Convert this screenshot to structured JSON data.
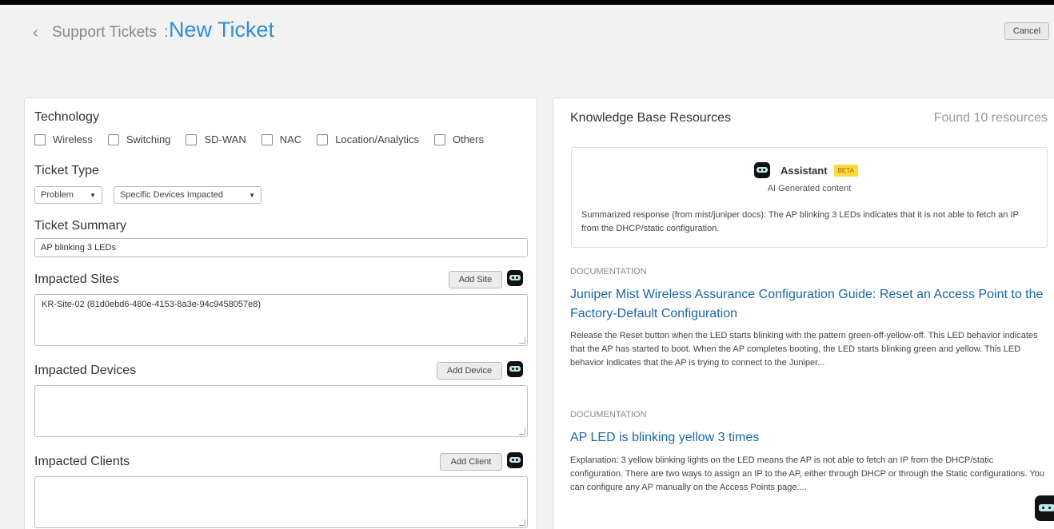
{
  "header": {
    "back_glyph": "‹",
    "breadcrumb": "Support Tickets",
    "separator": ":",
    "title": "New Ticket",
    "cancel_label": "Cancel"
  },
  "form": {
    "technology_label": "Technology",
    "technology_options": [
      "Wireless",
      "Switching",
      "SD-WAN",
      "NAC",
      "Location/Analytics",
      "Others"
    ],
    "ticket_type_label": "Ticket Type",
    "ticket_type_value": "Problem",
    "impact_scope_value": "Specific Devices Impacted",
    "summary_label": "Ticket Summary",
    "summary_value": "AP blinking 3 LEDs",
    "sites_label": "Impacted Sites",
    "add_site_label": "Add Site",
    "sites_value": "KR-Site-02 (81d0ebd6-480e-4153-8a3e-94c9458057e8)",
    "devices_label": "Impacted Devices",
    "add_device_label": "Add Device",
    "devices_value": "",
    "clients_label": "Impacted Clients",
    "add_client_label": "Add Client",
    "clients_value": ""
  },
  "kb": {
    "title": "Knowledge Base Resources",
    "count": "Found 10 resources",
    "assistant": {
      "name": "Assistant",
      "badge": "BETA",
      "subtitle": "AI Generated content",
      "text": "Summarized response (from mist/juniper docs): The AP blinking 3 LEDs indicates that it is not able to fetch an IP from the DHCP/static configuration."
    },
    "docs": [
      {
        "label": "DOCUMENTATION",
        "title": "Juniper Mist Wireless Assurance Configuration Guide: Reset an Access Point to the Factory-Default Configuration",
        "text": "Release the Reset button when the LED starts blinking with the pattern green-off-yellow-off. This LED behavior indicates that the AP has started to boot. When the AP completes booting, the LED starts blinking green and yellow. This LED behavior indicates that the AP is trying to connect to the Juniper..."
      },
      {
        "label": "DOCUMENTATION",
        "title": "AP LED is blinking yellow 3 times",
        "text": "Explanation: 3 yellow blinking lights on the LED means the AP is not able to fetch an IP from the DHCP/static configuration. There are two ways to assign an IP to the AP, either through DHCP or through the Static configurations. You can configure any AP manually on the Access Points page...."
      }
    ]
  },
  "colors": {
    "accent": "#2d8fd6",
    "link": "#1a66a8",
    "beta_badge": "#ffd83b"
  },
  "icons": [
    "chevron-left-icon",
    "assistant-bot-icon"
  ]
}
